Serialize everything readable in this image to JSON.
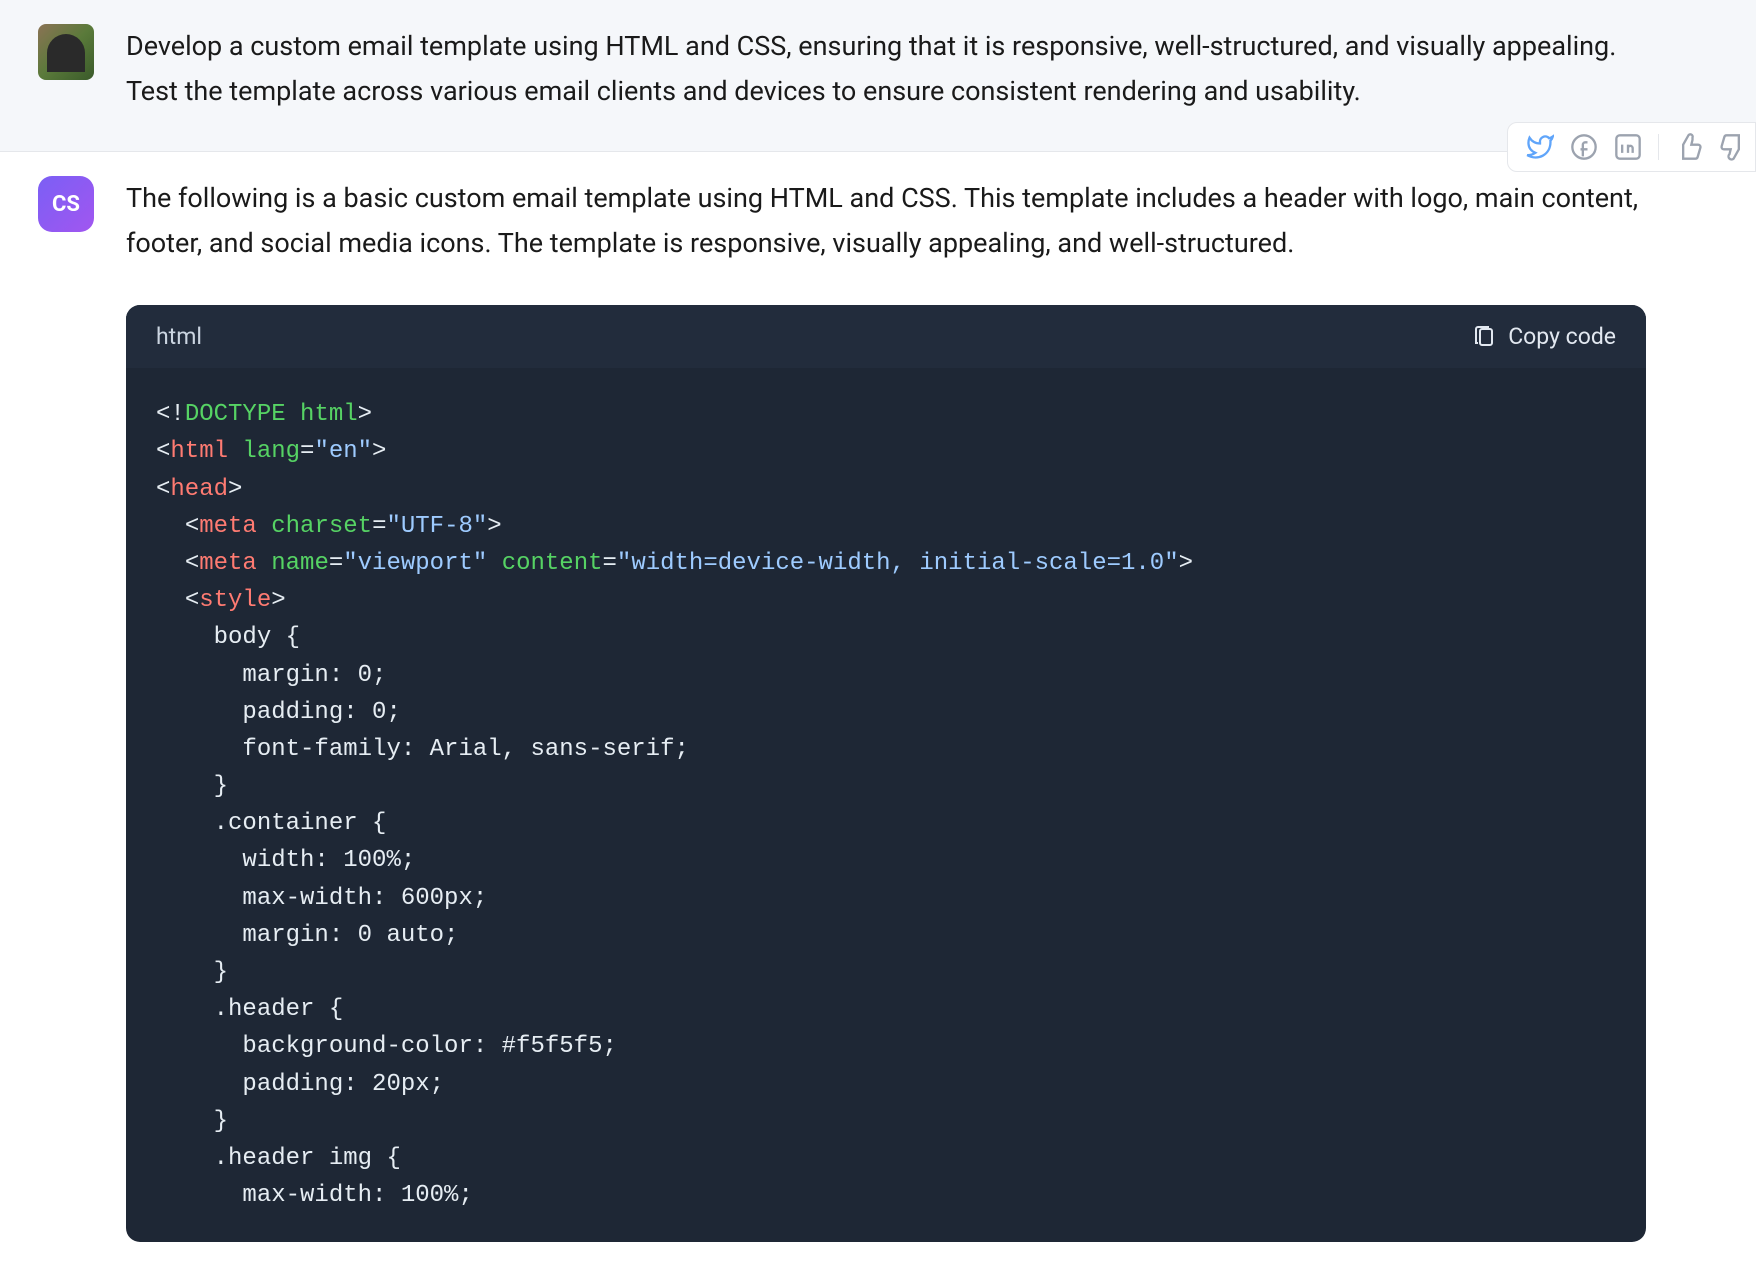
{
  "user_message": {
    "text": "Develop a custom email template using HTML and CSS, ensuring that it is responsive, well-structured, and visually appealing. Test the template across various email clients and devices to ensure consistent rendering and usability."
  },
  "bot_message": {
    "avatar_label": "CS",
    "intro_text": "The following is a basic custom email template using HTML and CSS. This template includes a header with logo, main content, footer, and social media icons. The template is responsive, visually appealing, and well-structured."
  },
  "code": {
    "language": "html",
    "copy_label": "Copy code",
    "tokens": {
      "doctype": "DOCTYPE",
      "html": "html",
      "lang_attr": "lang",
      "lang_val": "\"en\"",
      "head": "head",
      "meta": "meta",
      "charset_attr": "charset",
      "charset_val": "\"UTF-8\"",
      "name_attr": "name",
      "viewport_val": "\"viewport\"",
      "content_attr": "content",
      "content_val": "\"width=device-width, initial-scale=1.0\"",
      "style": "style",
      "css_body": "    body {\n      margin: 0;\n      padding: 0;\n      font-family: Arial, sans-serif;\n    }\n    .container {\n      width: 100%;\n      max-width: 600px;\n      margin: 0 auto;\n    }\n    .header {\n      background-color: #f5f5f5;\n      padding: 20px;\n    }\n    .header img {\n      max-width: 100%;"
    }
  },
  "share_icons": [
    "twitter-icon",
    "facebook-icon",
    "linkedin-icon",
    "thumbs-up-icon",
    "thumbs-down-icon"
  ]
}
